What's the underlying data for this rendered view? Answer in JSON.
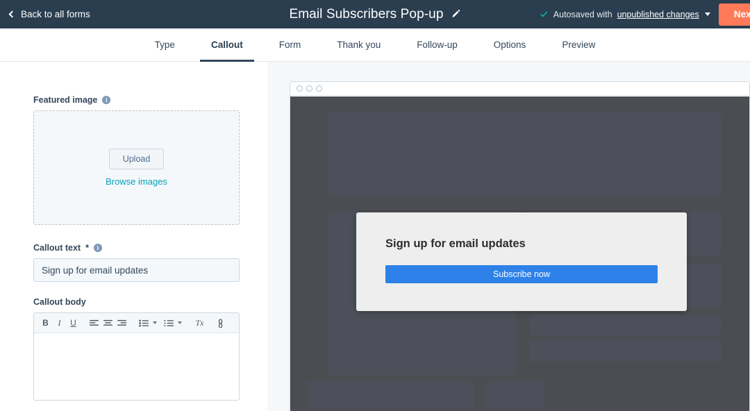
{
  "header": {
    "back_label": "Back to all forms",
    "back_icon": "chevron-left-icon",
    "title": "Email Subscribers Pop-up",
    "edit_icon": "pencil-icon",
    "status_check_icon": "check-icon",
    "autosave_prefix": "Autosaved with",
    "autosave_link": "unpublished changes",
    "autosave_caret_icon": "chevron-down-icon",
    "next_label": "Next",
    "bar_color": "#2a3e50",
    "next_color": "#ff7a59"
  },
  "tabs": [
    {
      "label": "Type",
      "active": false
    },
    {
      "label": "Callout",
      "active": true
    },
    {
      "label": "Form",
      "active": false
    },
    {
      "label": "Thank you",
      "active": false
    },
    {
      "label": "Follow-up",
      "active": false
    },
    {
      "label": "Options",
      "active": false
    },
    {
      "label": "Preview",
      "active": false
    }
  ],
  "editor": {
    "featured_image": {
      "label": "Featured image",
      "info_icon": "info-icon",
      "info_glyph": "i",
      "upload_label": "Upload",
      "browse_label": "Browse images",
      "link_color": "#00a4bd"
    },
    "callout_text": {
      "label": "Callout text",
      "required_marker": "*",
      "info_icon": "info-icon",
      "info_glyph": "i",
      "value": "Sign up for email updates",
      "placeholder": "Sign up for email updates"
    },
    "callout_body": {
      "label": "Callout body",
      "value": "",
      "toolbar": [
        {
          "name": "bold-icon",
          "glyph": "B",
          "style": "bold"
        },
        {
          "name": "italic-icon",
          "glyph": "I",
          "style": "italic"
        },
        {
          "name": "underline-icon",
          "glyph": "U",
          "style": "underline"
        },
        {
          "name": "align-left-icon",
          "glyph": "",
          "style": "svg"
        },
        {
          "name": "align-center-icon",
          "glyph": "",
          "style": "svg"
        },
        {
          "name": "align-right-icon",
          "glyph": "",
          "style": "svg"
        },
        {
          "name": "bulleted-list-icon",
          "glyph": "",
          "style": "svg"
        },
        {
          "name": "numbered-list-icon",
          "glyph": "",
          "style": "svg"
        },
        {
          "name": "clear-formatting-icon",
          "glyph": "Tx",
          "style": "tx"
        },
        {
          "name": "link-icon",
          "glyph": "",
          "style": "svg"
        }
      ]
    }
  },
  "preview": {
    "browser_dots": 3,
    "popup": {
      "heading": "Sign up for email updates",
      "cta_label": "Subscribe now",
      "cta_color": "#2d81e8",
      "background": "#eeeeee"
    },
    "page_background": "#4b4d52",
    "skeleton_color": "#4d505a"
  }
}
